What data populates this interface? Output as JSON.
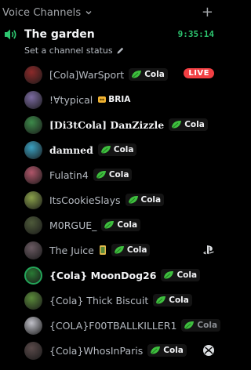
{
  "header": {
    "title": "Voice Channels",
    "chevron_icon": "chevron-down-icon",
    "add_icon": "plus-icon"
  },
  "channel": {
    "name": "The garden",
    "time": "9:35:14",
    "speaker_icon": "speaker-icon",
    "status_prompt": "Set a channel status",
    "edit_icon": "pencil-icon"
  },
  "colors": {
    "background": "#000000",
    "accent_green": "#2dc770",
    "live_red": "#f23f43"
  },
  "users": [
    {
      "name": "[Cola]WarSport",
      "tag": "Cola",
      "badge": "LIVE",
      "avatar_color": "#8c2a2a",
      "style": "normal"
    },
    {
      "name": "!∀typical",
      "tag": "BRIA",
      "tag_kind": "bria",
      "avatar_color": "#7b6aa0",
      "style": "normal"
    },
    {
      "name": "[Di3tCola] DanZizzle",
      "tag": "Cola",
      "avatar_color": "#3d8a4a",
      "style": "deco"
    },
    {
      "name": "damned",
      "tag": "Cola",
      "avatar_color": "#3aa0c0",
      "style": "deco"
    },
    {
      "name": "Fulatin4",
      "tag": "Cola",
      "avatar_color": "#b0566a",
      "style": "normal"
    },
    {
      "name": "ItsCookieSlays",
      "tag": "Cola",
      "avatar_color": "#8aa04a",
      "style": "normal"
    },
    {
      "name": "M0RGUE_",
      "tag": "Cola",
      "avatar_color": "#4e5a3a",
      "style": "normal"
    },
    {
      "name": "The Juice",
      "tag": "Cola",
      "avatar_color": "#6a5a62",
      "style": "normal",
      "mini_badge": true,
      "right_icon": "playstation-icon"
    },
    {
      "name": "{Cola} MoonDog26",
      "tag": "Cola",
      "avatar_color": "#2a7a34",
      "style": "bold"
    },
    {
      "name": "{Cola} Thick Biscuit",
      "tag": "Cola",
      "avatar_color": "#5a8a3a",
      "style": "normal"
    },
    {
      "name": "{COLA}F00TBALLKILLER1",
      "tag": "Cola",
      "avatar_color": "#c0c0c8",
      "style": "normal",
      "tag_fade": true
    },
    {
      "name": "{Cola}WhosInParis",
      "tag": "Cola",
      "avatar_color": "#5a4a4a",
      "style": "normal",
      "right_icon": "xbox-icon"
    }
  ]
}
